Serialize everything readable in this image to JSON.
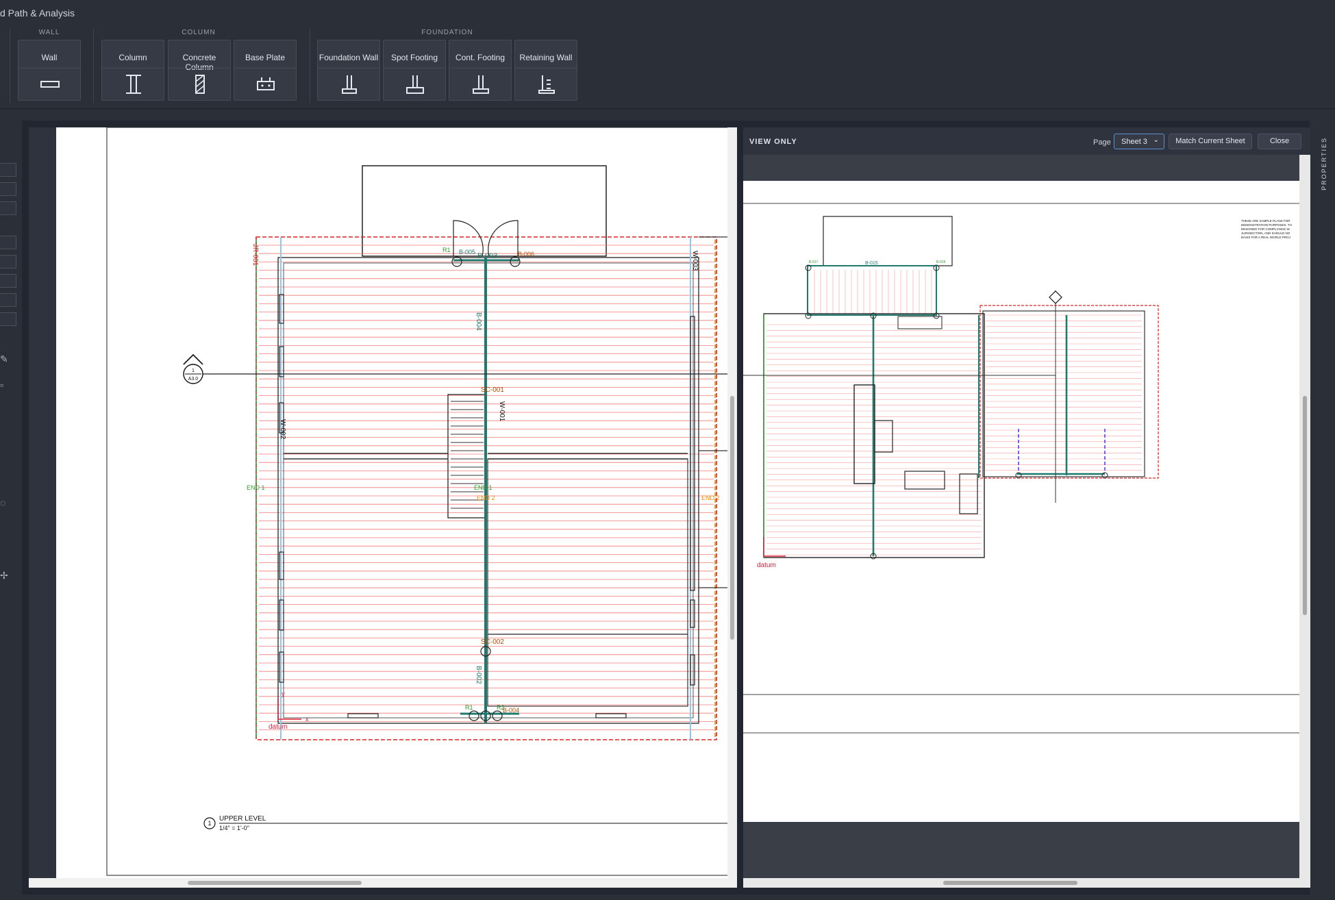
{
  "app": {
    "title": "d Path & Analysis"
  },
  "ribbon": {
    "groups": [
      {
        "label": "WALL"
      },
      {
        "label": "COLUMN"
      },
      {
        "label": "FOUNDATION"
      }
    ],
    "tools": [
      {
        "label": "Wall",
        "icon": "wall-icon"
      },
      {
        "label": "Column",
        "icon": "column-icon"
      },
      {
        "label": "Concrete Column",
        "icon": "concrete-column-icon"
      },
      {
        "label": "Base Plate",
        "icon": "base-plate-icon"
      },
      {
        "label": "Foundation Wall",
        "icon": "foundation-wall-icon"
      },
      {
        "label": "Spot Footing",
        "icon": "spot-footing-icon"
      },
      {
        "label": "Cont. Footing",
        "icon": "cont-footing-icon"
      },
      {
        "label": "Retaining Wall",
        "icon": "retaining-wall-icon"
      }
    ]
  },
  "left_drawing": {
    "labels": {
      "jr": "JR-001",
      "b005": "B-005",
      "b003": "B-003",
      "b006": "B-006",
      "w003": "W-003",
      "b004": "B-004",
      "sc001": "SC-001",
      "w001": "W-001",
      "w002": "W-002",
      "end1a": "END 1",
      "end1b": "END 1",
      "end2a": "END 2",
      "end2b": "END 2",
      "sc002": "SC-002",
      "b002": "B-002",
      "r1": "R1",
      "r2": "R2",
      "b004b": "B-004",
      "datum": "datum",
      "section_num": "1",
      "section_ref": "A3.0",
      "level_num": "1",
      "level_title": "UPPER LEVEL",
      "level_scale": "1/4\" = 1'-0\"",
      "axis_x": "x",
      "axis_y": "y"
    }
  },
  "right_panel": {
    "header": {
      "mode": "VIEW ONLY",
      "page_label": "Page",
      "sheet_selected": "Sheet 3",
      "match_button": "Match Current Sheet",
      "close_button": "Close"
    },
    "labels": {
      "note1": "THESE ARE SAMPLE PLANS FOR",
      "note2": "DEMONSTRATION PURPOSES. TH",
      "note3": "DESIGNED FOR COMPLIANCE W",
      "note4": "JURISDICTION, AND SHOULD NO",
      "note5": "BASIS FOR A REAL WORLD PROJ",
      "b017": "B-017",
      "b019": "B-019",
      "b015": "B-015",
      "datum": "datum"
    }
  },
  "properties_tab": {
    "label": "PROPERTIES"
  },
  "colors": {
    "chrome": "#2b2f38",
    "beam": "#1f7a6e",
    "joist": "#f07070",
    "boundary": "#e02020",
    "end1": "#2a9d2a",
    "end2": "#f08a00",
    "wall_blue": "#8fc8ee",
    "accent": "#5b8fd6"
  }
}
